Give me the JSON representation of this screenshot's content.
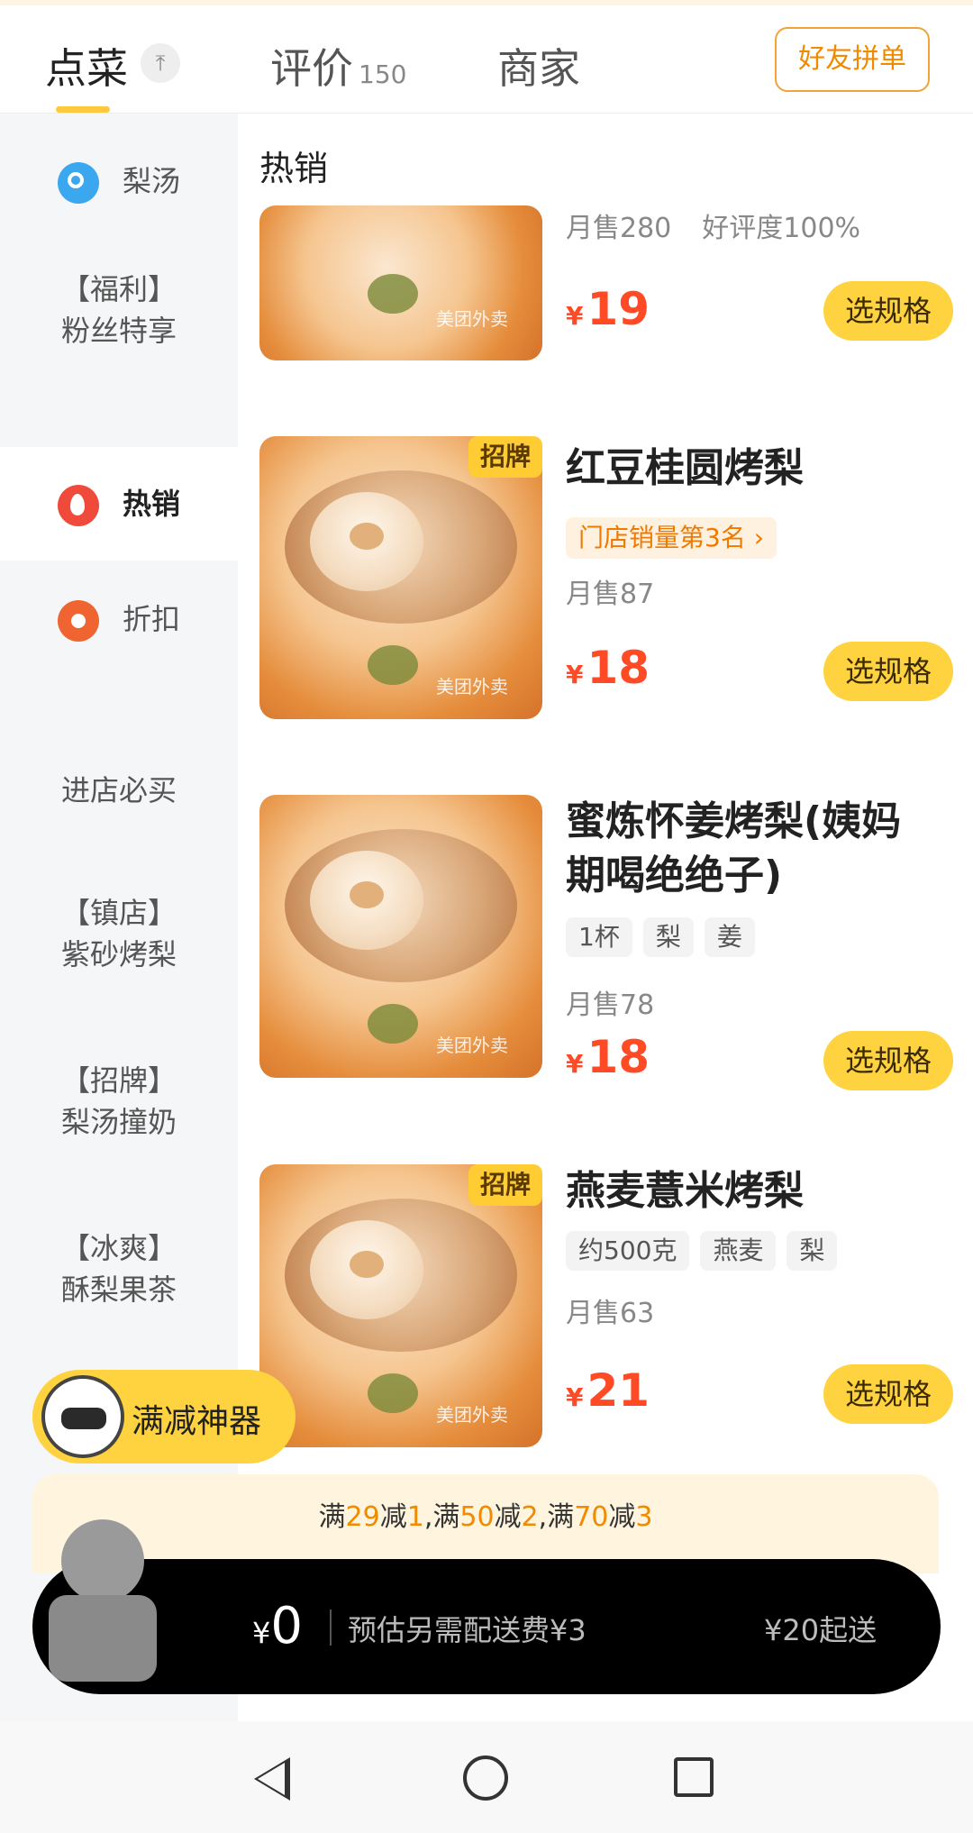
{
  "tabs": [
    {
      "label": "点菜",
      "active": true
    },
    {
      "label": "评价",
      "count": "150"
    },
    {
      "label": "商家"
    }
  ],
  "pin_icon_glyph": "⤒",
  "group_order_label": "好友拼单",
  "sidebar": {
    "items": [
      {
        "label": "梨汤",
        "icon": "search-icon"
      },
      {
        "label_line1": "【福利】",
        "label_line2": "粉丝特享"
      },
      {
        "label": "热销",
        "icon": "fire-icon",
        "active": true
      },
      {
        "label": "折扣",
        "icon": "discount-tag-icon"
      },
      {
        "label": "进店必买"
      },
      {
        "label_line1": "【镇店】",
        "label_line2": "紫砂烤梨"
      },
      {
        "label_line1": "【招牌】",
        "label_line2": "梨汤撞奶"
      },
      {
        "label_line1": "【冰爽】",
        "label_line2": "酥梨果茶"
      }
    ]
  },
  "section_title": "热销",
  "products": [
    {
      "name": "",
      "sold": "月售280",
      "rating": "好评度100%",
      "price": "19",
      "currency": "¥",
      "button": "选规格",
      "watermark": "美团外卖"
    },
    {
      "badge": "招牌",
      "name": "红豆桂圆烤梨",
      "rank": "门店销量第3名 ›",
      "sold": "月售87",
      "price": "18",
      "currency": "¥",
      "button": "选规格",
      "watermark": "美团外卖"
    },
    {
      "name_line1": "蜜炼怀姜烤梨(姨妈",
      "name_line2": "期喝绝绝子)",
      "tags": [
        "1杯",
        "梨",
        "姜"
      ],
      "sold": "月售78",
      "price": "18",
      "currency": "¥",
      "button": "选规格",
      "watermark": "美团外卖"
    },
    {
      "badge": "招牌",
      "name": "燕麦薏米烤梨",
      "tags": [
        "约500克",
        "燕麦",
        "梨"
      ],
      "sold": "月售63",
      "price": "21",
      "currency": "¥",
      "button": "选规格",
      "watermark": "美团外卖"
    }
  ],
  "helper": {
    "label": "满减神器"
  },
  "promo": {
    "parts": [
      "满",
      "29",
      "减",
      "1",
      ",满",
      "50",
      "减",
      "2",
      ",满",
      "70",
      "减",
      "3"
    ]
  },
  "cart": {
    "currency": "¥",
    "total": "0",
    "delivery_fee": "预估另需配送费¥3",
    "min_order": "¥20起送"
  },
  "colors": {
    "accent": "#ffd23f",
    "price": "#ff4a26",
    "badge": "#ffcc33",
    "orange_text": "#f08a00"
  }
}
